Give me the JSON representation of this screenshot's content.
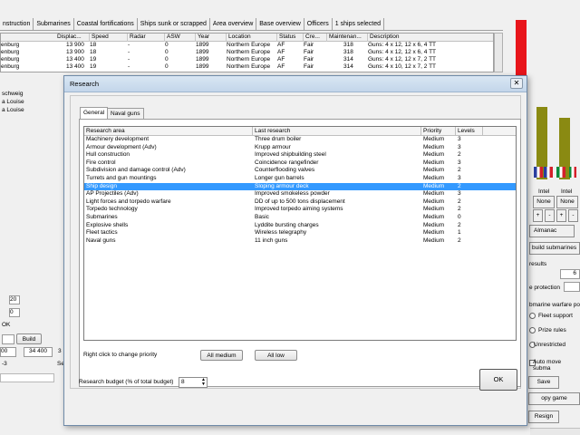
{
  "top_tabs": [
    "nstruction",
    "Submarines",
    "Coastal fortifications",
    "Ships sunk or scrapped",
    "Area overview",
    "Base overview",
    "Officers",
    "1 ships selected"
  ],
  "ship_table": {
    "headers": [
      "Displac...",
      "Speed",
      "Radar",
      "ASW",
      "Year",
      "Location",
      "Status",
      "Cre...",
      "Maintenan...",
      "Description"
    ],
    "rows": [
      {
        "name": "enburg",
        "displ": "13 900",
        "speed": "18",
        "radar": "-",
        "asw": "0",
        "year": "1899",
        "loc": "Northern Europe",
        "status": "AF",
        "crew": "Fair",
        "maint": "318",
        "desc": "Guns: 4 x 12, 12 x 6, 4 TT"
      },
      {
        "name": "enburg",
        "displ": "13 900",
        "speed": "18",
        "radar": "-",
        "asw": "0",
        "year": "1899",
        "loc": "Northern Europe",
        "status": "AF",
        "crew": "Fair",
        "maint": "318",
        "desc": "Guns: 4 x 12, 12 x 6, 4 TT"
      },
      {
        "name": "enburg",
        "displ": "13 400",
        "speed": "19",
        "radar": "-",
        "asw": "0",
        "year": "1899",
        "loc": "Northern Europe",
        "status": "AF",
        "crew": "Fair",
        "maint": "314",
        "desc": "Guns: 4 x 12, 12 x 7, 2 TT"
      },
      {
        "name": "enburg",
        "displ": "13 400",
        "speed": "19",
        "radar": "-",
        "asw": "0",
        "year": "1899",
        "loc": "Northern Europe",
        "status": "AF",
        "crew": "Fair",
        "maint": "314",
        "desc": "Guns: 4 x 10, 12 x 7, 2 TT"
      }
    ]
  },
  "left_panel": {
    "names": [
      "schweig",
      "a Louise",
      "a Louise"
    ],
    "values": [
      "20",
      "0",
      "OK"
    ],
    "build_label": "Build",
    "cost_a": "00",
    "cost_b": "34 400",
    "cost_c": "3",
    "misc": "-3",
    "se": "Se"
  },
  "right_panel": {
    "intel_labels": [
      "Intel",
      "Intel"
    ],
    "none_labels": [
      "None",
      "None"
    ],
    "steppers": [
      "+",
      "-",
      "+",
      "-"
    ],
    "almanac_label": "Almanac",
    "build_submarines_label": "build submarines",
    "results_label": "results",
    "results_value": "6",
    "protection_label": "e protection",
    "submarine_warfare_label": "bmarine warfare po",
    "fleet_support_label": "Fleet support",
    "prize_rules_label": "Prize rules",
    "unrestricted_label": "Unrestricted",
    "auto_move_label": "Auto move subma",
    "save_label": "Save",
    "copy_game_label": "opy game",
    "resign_label": "Resign",
    "colors": {
      "red": "#e8151b",
      "olive": "#8a8a12"
    }
  },
  "dialog": {
    "title": "Research",
    "close_glyph": "✕",
    "tabs": [
      "General",
      "Naval guns"
    ],
    "columns": [
      "Research area",
      "Last research",
      "Priority",
      "Levels"
    ],
    "rows": [
      {
        "area": "Machinery development",
        "last": "Three drum boiler",
        "priority": "Medium",
        "level": "3"
      },
      {
        "area": "Armour development (Adv)",
        "last": "Krupp armour",
        "priority": "Medium",
        "level": "3"
      },
      {
        "area": "Hull construction",
        "last": "Improved shipbuilding steel",
        "priority": "Medium",
        "level": "2"
      },
      {
        "area": "Fire control",
        "last": "Coincidence rangefinder",
        "priority": "Medium",
        "level": "3"
      },
      {
        "area": "Subdivision and damage control (Adv)",
        "last": "Counterflooding valves",
        "priority": "Medium",
        "level": "2"
      },
      {
        "area": "Turrets and gun mountings",
        "last": "Longer gun barrels",
        "priority": "Medium",
        "level": "3"
      },
      {
        "area": "Ship design",
        "last": "Sloping armour deck",
        "priority": "Medium",
        "level": "2"
      },
      {
        "area": "AP Projectiles (Adv)",
        "last": "Improved smokeless powder",
        "priority": "Medium",
        "level": "3"
      },
      {
        "area": "Light forces and torpedo warfare",
        "last": "DD of up to 500 tons displacement",
        "priority": "Medium",
        "level": "2"
      },
      {
        "area": "Torpedo technology",
        "last": "Improved torpedo aiming systems",
        "priority": "Medium",
        "level": "2"
      },
      {
        "area": "Submarines",
        "last": "Basic",
        "priority": "Medium",
        "level": "0"
      },
      {
        "area": "Explosive shells",
        "last": "Lyddite bursting charges",
        "priority": "Medium",
        "level": "2"
      },
      {
        "area": "Fleet tactics",
        "last": "Wireless telegraphy",
        "priority": "Medium",
        "level": "1"
      },
      {
        "area": "Naval guns",
        "last": "11 inch guns",
        "priority": "Medium",
        "level": "2"
      }
    ],
    "selected_row": 6,
    "hint": "Right click to change priority",
    "all_medium_label": "All medium",
    "all_low_label": "All low",
    "budget_label": "Research budget (% of total budget)",
    "budget_value": "8",
    "ok_label": "OK"
  }
}
